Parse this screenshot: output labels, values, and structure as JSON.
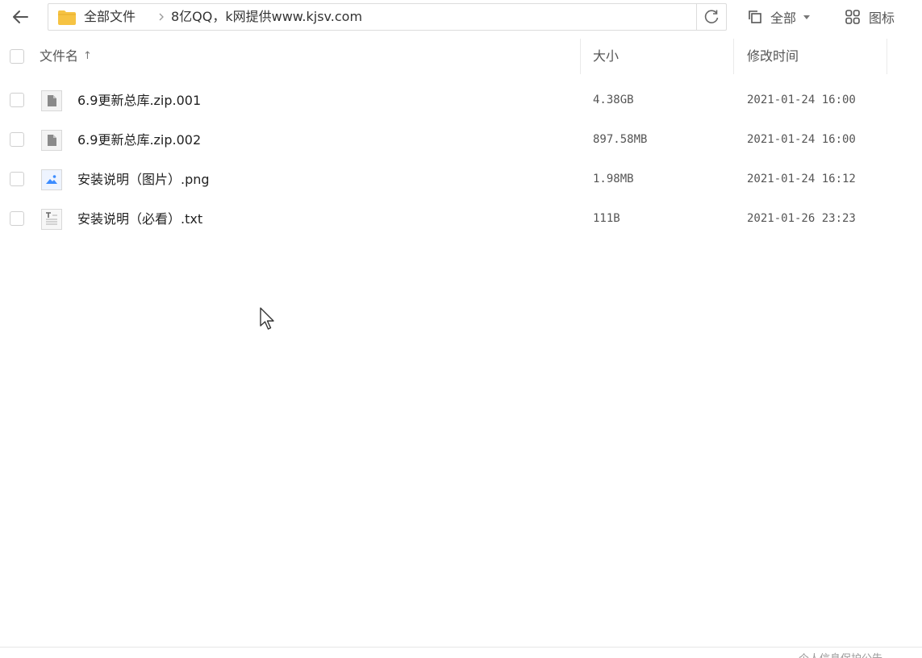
{
  "toolbar": {
    "back_icon": "arrow-left-icon",
    "breadcrumb": {
      "folder_icon": "folder-icon",
      "root": "全部文件",
      "current": "8亿QQ，k网提供www.kjsv.com"
    },
    "refresh_icon": "refresh-icon",
    "filter_label": "全部",
    "view_label": "图标"
  },
  "columns": {
    "name": "文件名",
    "sort_indicator": "↑",
    "size": "大小",
    "modified": "修改时间"
  },
  "files": [
    {
      "name": "6.9更新总库.zip.001",
      "size": "4.38GB",
      "modified": "2021-01-24 16:00",
      "icon": "generic-file-icon"
    },
    {
      "name": "6.9更新总库.zip.002",
      "size": "897.58MB",
      "modified": "2021-01-24 16:00",
      "icon": "generic-file-icon"
    },
    {
      "name": "安装说明（图片）.png",
      "size": "1.98MB",
      "modified": "2021-01-24 16:12",
      "icon": "image-file-icon"
    },
    {
      "name": "安装说明（必看）.txt",
      "size": "111B",
      "modified": "2021-01-26 23:23",
      "icon": "text-file-icon"
    }
  ],
  "footer": {
    "text": "个人信息保护公告"
  },
  "colors": {
    "folder": "#f6c343",
    "image_icon": "#3b8cff",
    "border": "#dcdcdc",
    "text": "#333333",
    "muted": "#555555"
  }
}
